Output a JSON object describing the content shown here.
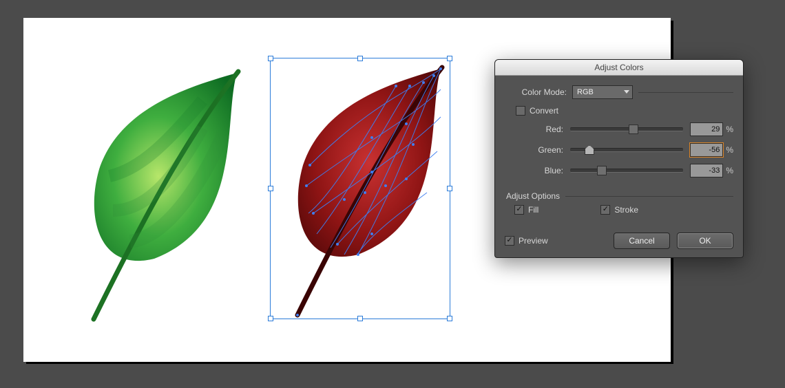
{
  "dialog": {
    "title": "Adjust Colors",
    "color_mode_label": "Color Mode:",
    "color_mode_value": "RGB",
    "convert_label": "Convert",
    "convert_checked": false,
    "sliders": {
      "red": {
        "label": "Red:",
        "value": "29",
        "pct": 56
      },
      "green": {
        "label": "Green:",
        "value": "-56",
        "pct": 17
      },
      "blue": {
        "label": "Blue:",
        "value": "-33",
        "pct": 28
      }
    },
    "adjust_options_label": "Adjust Options",
    "fill_label": "Fill",
    "stroke_label": "Stroke",
    "fill_checked": true,
    "stroke_checked": true,
    "preview_label": "Preview",
    "preview_checked": true,
    "cancel_label": "Cancel",
    "ok_label": "OK"
  }
}
